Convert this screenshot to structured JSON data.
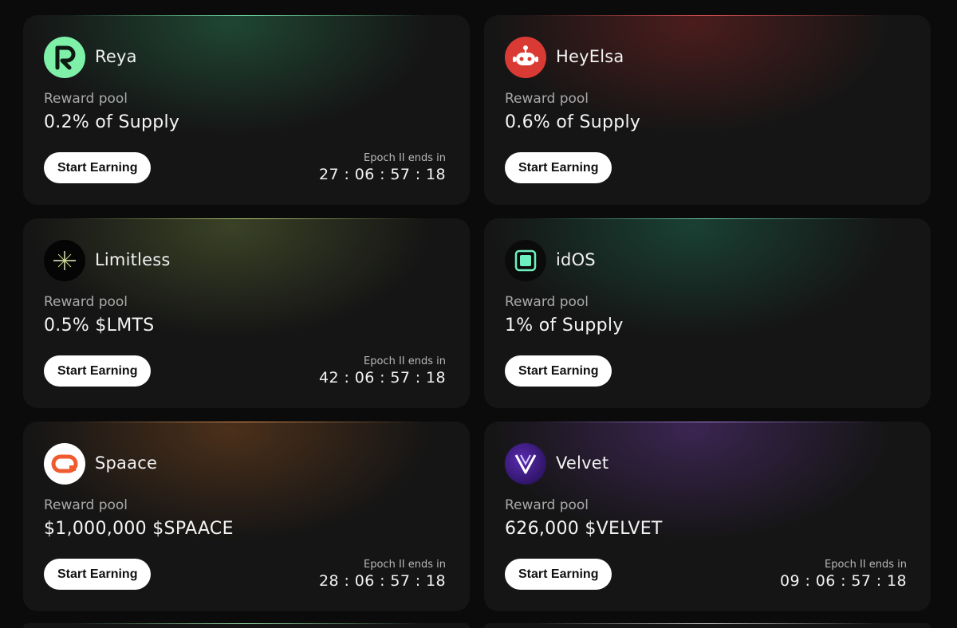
{
  "cards": [
    {
      "name": "Reya",
      "pool_label": "Reward pool",
      "pool_value": "0.2% of Supply",
      "button_label": "Start Earning",
      "epoch_label": "Epoch II ends in",
      "countdown": "27 : 06 : 57 : 18",
      "icon": "reya-logo-icon",
      "accent": "#2a6b4a"
    },
    {
      "name": "HeyElsa",
      "pool_label": "Reward pool",
      "pool_value": "0.6% of Supply",
      "button_label": "Start Earning",
      "epoch_label": "",
      "countdown": "",
      "icon": "heyelsa-logo-icon",
      "accent": "#6b2222"
    },
    {
      "name": "Limitless",
      "pool_label": "Reward pool",
      "pool_value": "0.5% $LMTS",
      "button_label": "Start Earning",
      "epoch_label": "Epoch II ends in",
      "countdown": "42 : 06 : 57 : 18",
      "icon": "limitless-logo-icon",
      "accent": "#4a5a2a"
    },
    {
      "name": "idOS",
      "pool_label": "Reward pool",
      "pool_value": "1% of Supply",
      "button_label": "Start Earning",
      "epoch_label": "",
      "countdown": "",
      "icon": "idos-logo-icon",
      "accent": "#1f5a44"
    },
    {
      "name": "Spaace",
      "pool_label": "Reward pool",
      "pool_value": "$1,000,000 $SPAACE",
      "button_label": "Start Earning",
      "epoch_label": "Epoch II ends in",
      "countdown": "28 : 06 : 57 : 18",
      "icon": "spaace-logo-icon",
      "accent": "#6b3a1a"
    },
    {
      "name": "Velvet",
      "pool_label": "Reward pool",
      "pool_value": "626,000 $VELVET",
      "button_label": "Start Earning",
      "epoch_label": "Epoch II ends in",
      "countdown": "09 : 06 : 57 : 18",
      "icon": "velvet-logo-icon",
      "accent": "#4a2a6b"
    }
  ]
}
